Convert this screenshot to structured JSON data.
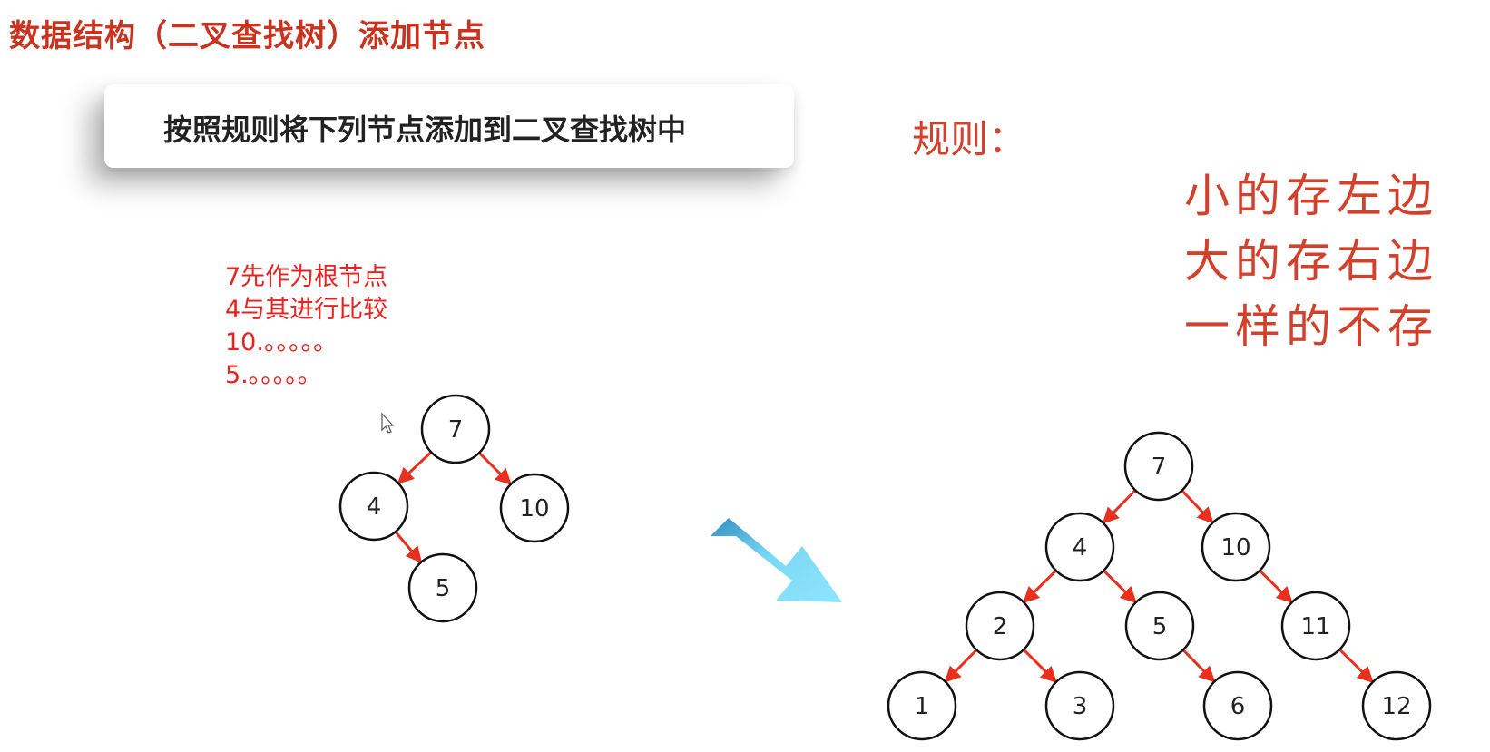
{
  "title": "数据结构（二叉查找树）添加节点",
  "banner": "按照规则将下列节点添加到二叉查找树中",
  "steps": [
    "7先作为根节点",
    "4与其进行比较",
    "10.。。。。。",
    "5.。。。。。"
  ],
  "rule_label": "规则：",
  "rules": [
    "小的存左边",
    "大的存右边",
    "一样的不存"
  ],
  "colors": {
    "title": "#c8341f",
    "steps": "#e8231f",
    "rules": "#d2412b",
    "edge": "#e8301f",
    "node_stroke": "#111111",
    "arrow_light": "#7ad8f5",
    "arrow_dark": "#2f8fc0"
  },
  "small_tree": {
    "nodes": [
      {
        "id": "7",
        "label": "7"
      },
      {
        "id": "4",
        "label": "4"
      },
      {
        "id": "10",
        "label": "10"
      },
      {
        "id": "5",
        "label": "5"
      }
    ],
    "edges": [
      [
        "7",
        "4"
      ],
      [
        "7",
        "10"
      ],
      [
        "4",
        "5"
      ]
    ]
  },
  "big_tree": {
    "nodes": [
      {
        "id": "7",
        "label": "7"
      },
      {
        "id": "4",
        "label": "4"
      },
      {
        "id": "10",
        "label": "10"
      },
      {
        "id": "2",
        "label": "2"
      },
      {
        "id": "5",
        "label": "5"
      },
      {
        "id": "11",
        "label": "11"
      },
      {
        "id": "1",
        "label": "1"
      },
      {
        "id": "3",
        "label": "3"
      },
      {
        "id": "6",
        "label": "6"
      },
      {
        "id": "12",
        "label": "12"
      }
    ],
    "edges": [
      [
        "7",
        "4"
      ],
      [
        "7",
        "10"
      ],
      [
        "4",
        "2"
      ],
      [
        "4",
        "5"
      ],
      [
        "10",
        "11"
      ],
      [
        "2",
        "1"
      ],
      [
        "2",
        "3"
      ],
      [
        "5",
        "6"
      ],
      [
        "11",
        "12"
      ]
    ]
  }
}
